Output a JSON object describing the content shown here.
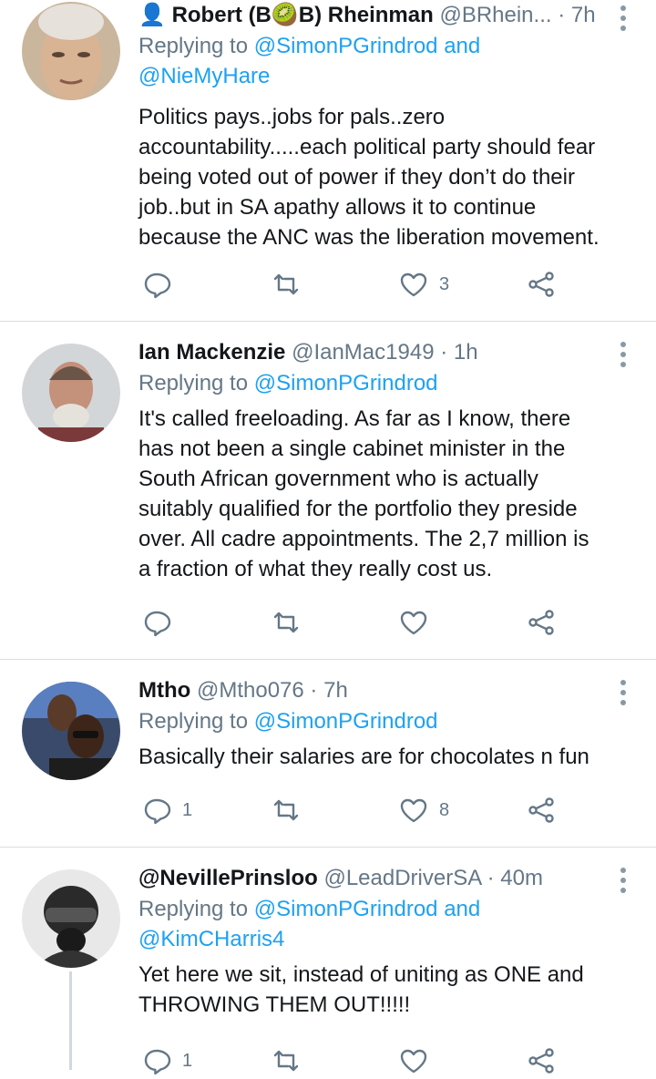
{
  "tweets": [
    {
      "name": "Robert (B🥝B) Rheinman",
      "name_prefix_icon": "person-icon",
      "handle": "@BRhein...",
      "time": "7h",
      "reply_prefix": "Replying to",
      "reply_targets": "@SimonPGrindrod and",
      "reply_targets_2": "@NieMyHare",
      "text": "Politics pays..jobs for pals..zero accountability.....each political party should fear being voted out of power if they don’t do their job..but in SA apathy allows it to continue because the ANC was the liberation movement.",
      "replies": "",
      "likes": "3"
    },
    {
      "name": "Ian Mackenzie",
      "handle": "@IanMac1949",
      "time": "1h",
      "reply_prefix": "Replying to",
      "reply_targets": "@SimonPGrindrod",
      "text": "It's called freeloading.  As far as I know,  there has not been a single cabinet minister in the South African government who is actually suitably qualified for the portfolio they preside over. All cadre appointments. The 2,7 million is a fraction of what they really cost us.",
      "replies": "",
      "likes": ""
    },
    {
      "name": "Mtho",
      "handle": "@Mtho076",
      "time": "7h",
      "reply_prefix": "Replying to",
      "reply_targets": "@SimonPGrindrod",
      "text": "Basically their salaries are for chocolates n fun",
      "replies": "1",
      "likes": "8"
    },
    {
      "name": "@NevillePrinsloo",
      "handle": "@LeadDriverSA",
      "time": "40m",
      "reply_prefix": "Replying to",
      "reply_targets": "@SimonPGrindrod and",
      "reply_targets_2": "@KimCHarris4",
      "text": "Yet here we sit, instead of uniting as ONE and THROWING THEM OUT!!!!!",
      "replies": "1",
      "likes": ""
    }
  ],
  "separator": "·",
  "colors": {
    "accent": "#1da1f2",
    "muted": "#657786",
    "text": "#14171a",
    "divider": "#d9dde0"
  },
  "icons": [
    "reply-icon",
    "retweet-icon",
    "like-icon",
    "share-icon",
    "more-options-icon"
  ]
}
